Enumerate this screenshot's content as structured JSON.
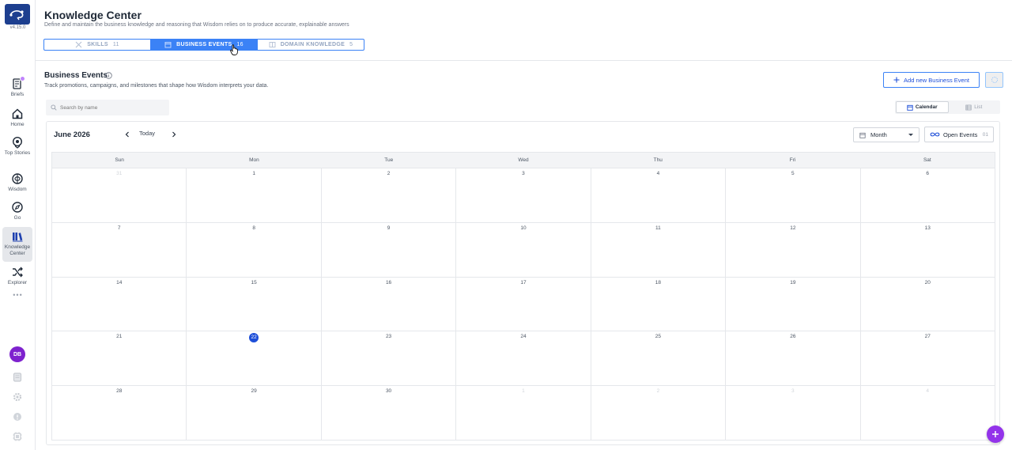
{
  "app": {
    "version": "v4.15.0",
    "accent": "#3b82f6",
    "brand": "#1d3f8f"
  },
  "sidebar": {
    "items": [
      {
        "label": "Briefs",
        "icon": "briefs-icon"
      },
      {
        "label": "Home",
        "icon": "home-icon"
      },
      {
        "label": "Top Stories",
        "icon": "top-stories-icon"
      },
      {
        "label": "Wisdom",
        "icon": "wisdom-icon"
      },
      {
        "label": "Go",
        "icon": "compass-icon"
      },
      {
        "label": "Knowledge Center",
        "icon": "knowledge-center-icon",
        "active": true
      },
      {
        "label": "Explorer",
        "icon": "shuffle-icon"
      }
    ],
    "more": "•••",
    "avatar_initials": "DB"
  },
  "header": {
    "title": "Knowledge Center",
    "subtitle": "Define and maintain the business knowledge and reasoning that Wisdom relies on to produce accurate, explainable answers",
    "tabs": [
      {
        "label": "SKILLS",
        "count": "11"
      },
      {
        "label": "BUSINESS EVENTS",
        "count": "16",
        "active": true
      },
      {
        "label": "DOMAIN KNOWLEDGE",
        "count": "5"
      }
    ]
  },
  "section": {
    "title": "Business Events",
    "subtitle": "Track promotions, campaigns, and milestones that shape how Wisdom interprets your data.",
    "add_button": "Add new Business Event",
    "search_placeholder": "Search by name",
    "views": [
      "Calendar",
      "List"
    ],
    "active_view": "Calendar"
  },
  "calendar": {
    "month_label": "June 2026",
    "today_label": "Today",
    "view_select": "Month",
    "open_events_label": "Open Events",
    "open_events_count": "01",
    "weekdays": [
      "Sun",
      "Mon",
      "Tue",
      "Wed",
      "Thu",
      "Fri",
      "Sat"
    ],
    "weeks": [
      [
        {
          "d": "31",
          "muted": true
        },
        {
          "d": "1"
        },
        {
          "d": "2"
        },
        {
          "d": "3"
        },
        {
          "d": "4"
        },
        {
          "d": "5"
        },
        {
          "d": "6"
        }
      ],
      [
        {
          "d": "7"
        },
        {
          "d": "8"
        },
        {
          "d": "9"
        },
        {
          "d": "10"
        },
        {
          "d": "11"
        },
        {
          "d": "12"
        },
        {
          "d": "13"
        }
      ],
      [
        {
          "d": "14"
        },
        {
          "d": "15"
        },
        {
          "d": "16"
        },
        {
          "d": "17"
        },
        {
          "d": "18"
        },
        {
          "d": "19"
        },
        {
          "d": "20"
        }
      ],
      [
        {
          "d": "21"
        },
        {
          "d": "22",
          "today": true
        },
        {
          "d": "23"
        },
        {
          "d": "24"
        },
        {
          "d": "25"
        },
        {
          "d": "26"
        },
        {
          "d": "27"
        }
      ],
      [
        {
          "d": "28"
        },
        {
          "d": "29"
        },
        {
          "d": "30"
        },
        {
          "d": "1",
          "muted": true
        },
        {
          "d": "2",
          "muted": true
        },
        {
          "d": "3",
          "muted": true
        },
        {
          "d": "4",
          "muted": true
        }
      ]
    ]
  }
}
